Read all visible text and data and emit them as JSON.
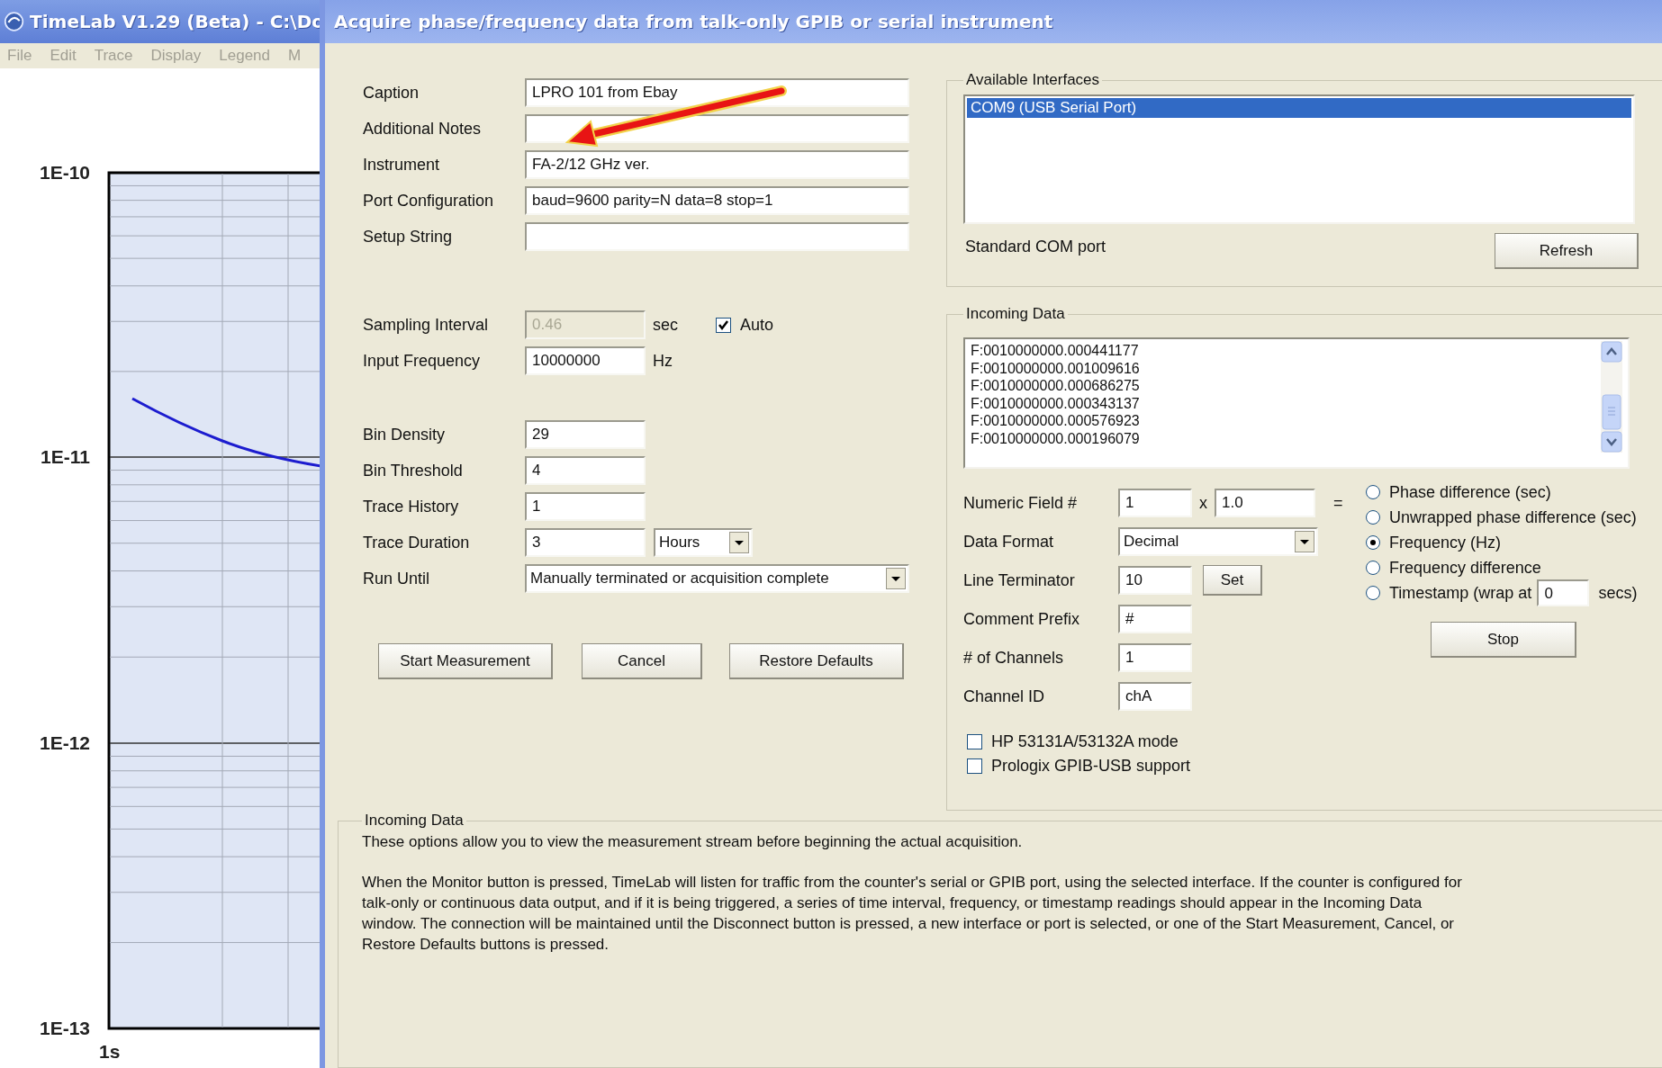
{
  "background_window": {
    "title": "TimeLab V1.29 (Beta) - C:\\Do",
    "menu": [
      "File",
      "Edit",
      "Trace",
      "Display",
      "Legend",
      "M"
    ],
    "plot": {
      "y_labels": [
        "1E-10",
        "1E-11",
        "1E-12",
        "1E-13"
      ],
      "x_labels": [
        "1s"
      ]
    }
  },
  "dialog": {
    "title": "Acquire phase/frequency data from talk-only GPIB or serial instrument",
    "text_fields": [
      {
        "label": "Caption",
        "value": "LPRO 101 from Ebay"
      },
      {
        "label": "Additional Notes"
      },
      {
        "label": "Instrument",
        "value": "FA-2/12 GHz ver."
      },
      {
        "label": "Port Configuration",
        "value": "baud=9600 parity=N data=8 stop=1"
      },
      {
        "label": "Setup String"
      }
    ],
    "sampling_interval": {
      "label": "Sampling Interval",
      "value": "0.46",
      "disabled": true,
      "unit": "sec",
      "auto": {
        "label": "Auto",
        "checked": true
      }
    },
    "input_frequency": {
      "label": "Input Frequency",
      "value": "10000000",
      "unit": "Hz"
    },
    "trace_fields": [
      {
        "label": "Bin Density",
        "value": "29"
      },
      {
        "label": "Bin Threshold",
        "value": "4"
      },
      {
        "label": "Trace History",
        "value": "1"
      }
    ],
    "trace_duration": {
      "label": "Trace Duration",
      "value": "3",
      "unit": "Hours"
    },
    "run_until": {
      "label": "Run Until",
      "value": "Manually terminated or acquisition complete"
    },
    "buttons": [
      "Start Measurement",
      "Cancel",
      "Restore Defaults"
    ],
    "available_interfaces": {
      "title": "Available Interfaces",
      "items": [
        {
          "label": "COM9 (USB Serial Port)",
          "selected": true
        }
      ],
      "port_type": "Standard COM port",
      "refresh_button": "Refresh"
    },
    "incoming_data": {
      "title": "Incoming Data",
      "lines": [
        "F:0010000000.000441177",
        "F:0010000000.001009616",
        "F:0010000000.000686275",
        "F:0010000000.000343137",
        "F:0010000000.000576923",
        "F:0010000000.000196079"
      ],
      "numeric_field": {
        "label": "Numeric Field #",
        "value": "1",
        "times_sign": "x",
        "multiplier": "1.0",
        "equals_sign": "="
      },
      "data_format": {
        "label": "Data Format",
        "value": "Decimal"
      },
      "line_terminator": {
        "label": "Line Terminator",
        "value": "10",
        "button": "Set"
      },
      "fields": [
        {
          "label": "Comment Prefix",
          "value": "#"
        },
        {
          "label": "# of Channels",
          "value": "1"
        },
        {
          "label": "Channel ID",
          "value": "chA"
        }
      ],
      "quantity_options": [
        {
          "kind": "plain",
          "label": "Phase difference (sec)",
          "selected": false
        },
        {
          "kind": "plain",
          "label": "Unwrapped phase difference (sec)",
          "selected": false
        },
        {
          "kind": "plain",
          "label": "Frequency (Hz)",
          "selected": true
        },
        {
          "kind": "plain",
          "label": "Frequency difference",
          "selected": false
        },
        {
          "kind": "wrap",
          "label": "Timestamp (wrap at",
          "value": "0",
          "suffix": "secs)",
          "selected": false
        }
      ],
      "stop_button": "Stop",
      "checkboxes": [
        {
          "label": "HP 53131A/53132A mode",
          "checked": false
        },
        {
          "label": "Prologix GPIB-USB support",
          "checked": false
        }
      ]
    },
    "help": {
      "title": "Incoming Data",
      "paragraphs": [
        "These options allow you to view the measurement stream before beginning the actual acquisition.",
        "When the Monitor button is pressed, TimeLab will listen for traffic from the counter's serial or GPIB port, using the selected interface.  If the counter is configured for talk-only or continuous data output, and if it is being triggered, a series of time interval, frequency, or timestamp readings should appear in the Incoming Data window. The connection will be maintained until the Disconnect button is pressed, a new interface or port is selected, or one of the Start Measurement, Cancel, or Restore Defaults buttons is pressed."
      ]
    }
  }
}
